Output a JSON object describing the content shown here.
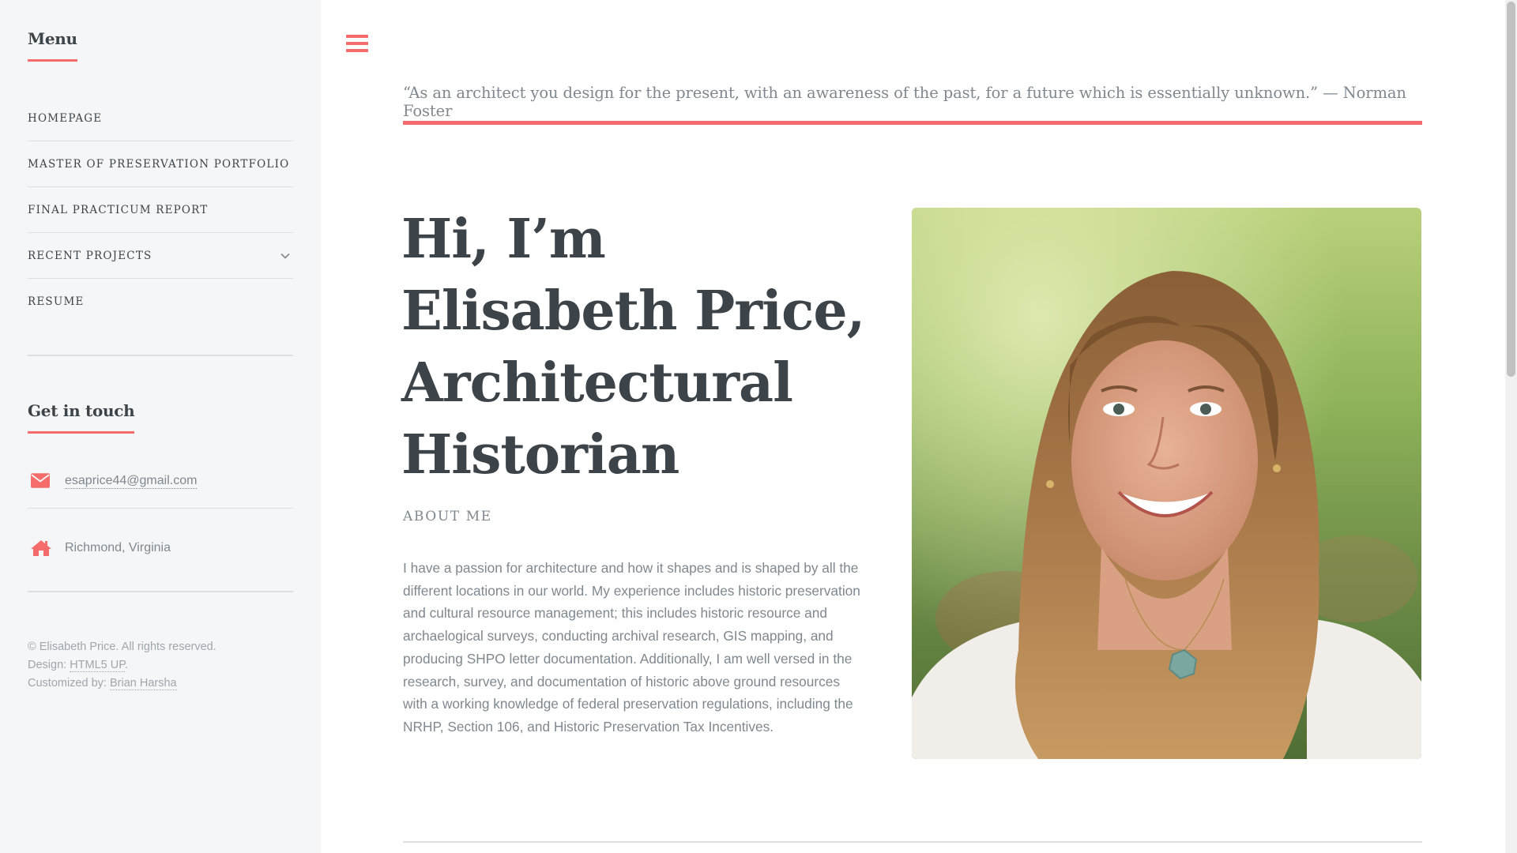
{
  "sidebar": {
    "menu_heading": "Menu",
    "menu_items": [
      {
        "label": "HOMEPAGE"
      },
      {
        "label": "MASTER OF PRESERVATION PORTFOLIO"
      },
      {
        "label": "FINAL PRACTICUM REPORT"
      },
      {
        "label": "RECENT PROJECTS",
        "has_submenu": true
      },
      {
        "label": "RESUME"
      }
    ],
    "contact_heading": "Get in touch",
    "email": "esaprice44@gmail.com",
    "location": "Richmond, Virginia",
    "footer": {
      "copyright": "© Elisabeth Price. All rights reserved.",
      "design_prefix": "Design: ",
      "design_link": "HTML5 UP",
      "design_suffix": ".",
      "customized_prefix": "Customized by: ",
      "customized_link": "Brian Harsha"
    }
  },
  "header": {
    "menu_icon": "hamburger-icon",
    "quote": "“As an architect you design for the present, with an awareness of the past, for a future which is essentially unknown.” — Norman Foster"
  },
  "hero": {
    "title": "Hi, I’m Elisabeth Price, Architectural Historian",
    "subtitle": "ABOUT ME",
    "bio": "I have a passion for architecture and how it shapes and is shaped by all the different locations in our world. My experience includes historic preservation and cultural resource management; this includes historic resource and archaelogical surveys, conducting archival research, GIS mapping, and producing SHPO letter documentation. Additionally, I am well versed in the research, survey, and documentation of historic above ground resources with a working knowledge of federal preservation regulations, including the NRHP, Section 106, and Historic Preservation Tax Incentives."
  },
  "icons": {
    "email": "envelope-icon",
    "location": "home-icon",
    "submenu": "chevron-down-icon"
  },
  "colors": {
    "accent": "#f56a6a",
    "heading": "#3d4449",
    "text": "#7f888f",
    "sidebar_bg": "#f5f6f7",
    "divider": "#dde0e3"
  }
}
